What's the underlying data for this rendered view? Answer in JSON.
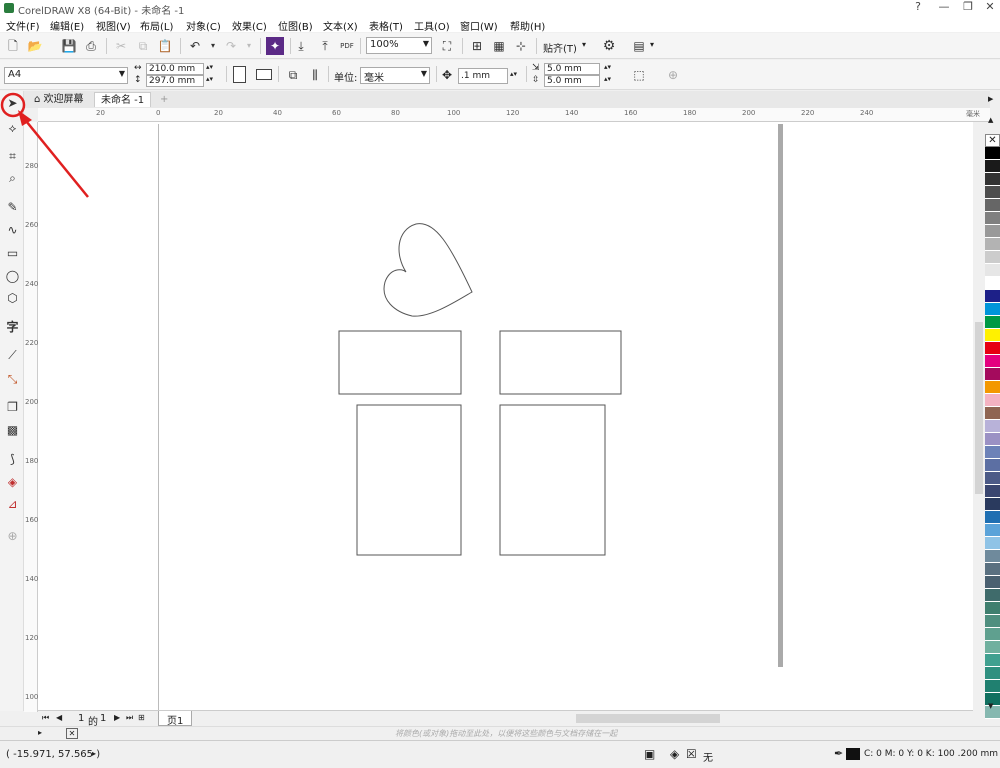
{
  "window": {
    "title": "CorelDRAW X8 (64-Bit) - 未命名 -1",
    "controls": [
      "?",
      "—",
      "❐",
      "✕"
    ]
  },
  "menu": [
    "文件(F)",
    "编辑(E)",
    "视图(V)",
    "布局(L)",
    "对象(C)",
    "效果(C)",
    "位图(B)",
    "文本(X)",
    "表格(T)",
    "工具(O)",
    "窗口(W)",
    "帮助(H)"
  ],
  "toolbar1": {
    "zoom": "100%",
    "snap_label": "贴齐(T)",
    "pdf_label": "PDF"
  },
  "toolbar2": {
    "paper": "A4",
    "width": "210.0 mm",
    "height": "297.0 mm",
    "units_label": "单位:",
    "units_value": "毫米",
    "nudge": ".1 mm",
    "dup_x": "5.0 mm",
    "dup_y": "5.0 mm"
  },
  "tabs": {
    "welcome": "欢迎屏幕",
    "document": "未命名 -1",
    "add": "+"
  },
  "ruler": {
    "top_ticks": [
      "20",
      "0",
      "20",
      "40",
      "60",
      "80",
      "100",
      "120",
      "140",
      "160",
      "180",
      "200",
      "220",
      "240"
    ],
    "unit": "毫米",
    "left_ticks": [
      "280",
      "260",
      "240",
      "220",
      "200",
      "180",
      "160",
      "140",
      "120",
      "100",
      "80"
    ]
  },
  "page_nav": {
    "current": "1",
    "of_label": "的",
    "total": "1",
    "page_tab": "页1"
  },
  "hint": "将颜色(或对象)拖动至此处，以便将这些颜色与文档存储在一起",
  "status": {
    "coords": "( -15.971, 57.565 )",
    "fill_none": "无",
    "outline_info": "C: 0 M: 0 Y: 0 K: 100  .200 mm"
  },
  "palette": [
    "#ffffff",
    "#000000",
    "#1a1a1a",
    "#333333",
    "#4d4d4d",
    "#666666",
    "#808080",
    "#999999",
    "#b3b3b3",
    "#cccccc",
    "#e6e6e6",
    "#ffffff",
    "#1d2088",
    "#0095d9",
    "#009944",
    "#fff100",
    "#e60012",
    "#e4007f",
    "#a40b5d",
    "#f39800",
    "#f4b3c2",
    "#8f6552",
    "#b8b2d9",
    "#9b91c4",
    "#6d82b8",
    "#5c6fa3",
    "#4c5a87",
    "#3a4670",
    "#2a3a5e",
    "#1f6fb2",
    "#5ba3d9",
    "#8fc3e6",
    "#6f8a9c",
    "#5a7080",
    "#4a6070",
    "#3f6b6b",
    "#3f7f6f",
    "#4f8f7f",
    "#5fa08f",
    "#70b09f",
    "#40a090",
    "#2f9080",
    "#208070",
    "#107060",
    "#86b8b0"
  ]
}
